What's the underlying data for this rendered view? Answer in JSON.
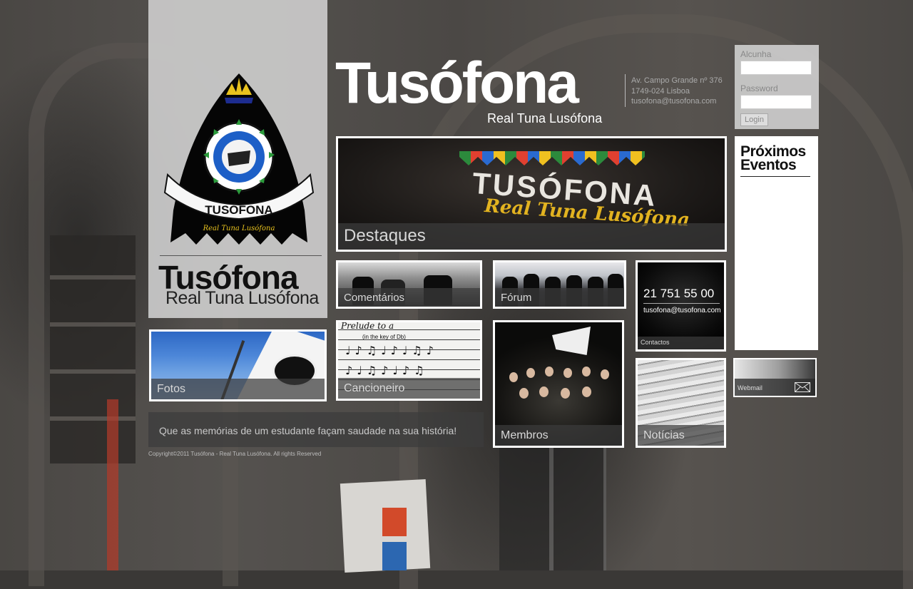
{
  "brand": {
    "title": "Tusófona",
    "subtitle": "Real Tuna Lusófona",
    "address_line1": "Av. Campo Grande nº 376",
    "address_line2": "1749-024 Lisboa",
    "email": "tusofona@tusofona.com"
  },
  "logo_panel": {
    "title": "Tusófona",
    "subtitle": "Real Tuna Lusófona",
    "emblem_text": "TUSÓFONA",
    "emblem_script": "Real Tuna Lusófona"
  },
  "tiles": {
    "destaques": "Destaques",
    "destaques_patch": "TUSÓFONA",
    "destaques_script": "Real Tuna Lusófona",
    "comentarios": "Comentários",
    "forum": "Fórum",
    "cancioneiro": "Cancioneiro",
    "cancioneiro_title": "Prelude to a",
    "cancioneiro_key": "(in the key of Db)",
    "membros": "Membros",
    "fotos": "Fotos",
    "noticias": "Notícias",
    "contactos": "Contactos",
    "contact_phone": "21 751 55 00",
    "contact_email": "tusofona@tusofona.com"
  },
  "login": {
    "alcunha_label": "Alcunha",
    "password_label": "Password",
    "alcunha_value": "",
    "password_value": "",
    "button": "Login"
  },
  "events": {
    "title_line1": "Próximos",
    "title_line2": "Eventos"
  },
  "webmail": {
    "label": "Webmail",
    "icon": "envelope-icon"
  },
  "footer": {
    "quote": "Que as memórias de um estudante façam saudade na sua história!",
    "copyright": "Copyright©2011 Tusófona - Real Tuna Lusófona. All rights Reserved"
  },
  "colors": {
    "tile_border": "#ffffff",
    "caption_bg": "#3c3c3c",
    "panel_bg": "#d2d2d2"
  }
}
